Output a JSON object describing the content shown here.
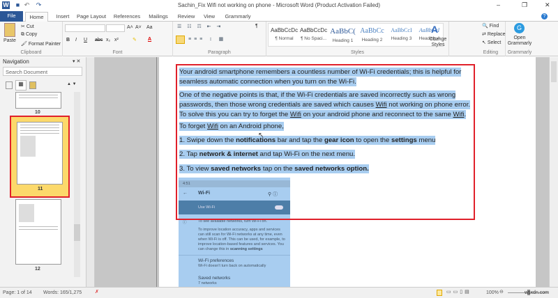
{
  "window": {
    "title": "Sachin_Fix Wifi not working on phone - Microsoft Word (Product Activation Failed)",
    "minimize": "–",
    "restore": "❐",
    "close": "✕"
  },
  "tabs": [
    "File",
    "Home",
    "Insert",
    "Page Layout",
    "References",
    "Mailings",
    "Review",
    "View",
    "Grammarly"
  ],
  "clipboard": {
    "paste": "Paste",
    "cut": "Cut",
    "copy": "Copy",
    "format_painter": "Format Painter",
    "label": "Clipboard"
  },
  "font": {
    "label": "Font",
    "bold": "B",
    "italic": "I",
    "underline": "U",
    "strike": "abc",
    "sub": "x₂",
    "sup": "x²",
    "grow": "A˄",
    "shrink": "A˅",
    "case": "Aa"
  },
  "paragraph": {
    "label": "Paragraph",
    "pilcrow": "¶"
  },
  "styles": {
    "label": "Styles",
    "items": [
      {
        "preview": "AaBbCcDc",
        "name": "¶ Normal"
      },
      {
        "preview": "AaBbCcDc",
        "name": "¶ No Spaci..."
      },
      {
        "preview": "AaBbC(",
        "name": "Heading 1"
      },
      {
        "preview": "AaBbCc",
        "name": "Heading 2"
      },
      {
        "preview": "AaBbCcI",
        "name": "Heading 3"
      },
      {
        "preview": "AaBbCcI",
        "name": "Heading 4"
      }
    ],
    "change_styles": "Change Styles"
  },
  "editing": {
    "label": "Editing",
    "find": "Find",
    "replace": "Replace",
    "select": "Select"
  },
  "grammarly": {
    "label": "Grammarly",
    "open": "Open Grammarly"
  },
  "navigation": {
    "title": "Navigation",
    "search_placeholder": "Search Document",
    "pages": [
      "10",
      "11",
      "12"
    ]
  },
  "document": {
    "p1": "Your android smartphone remembers a countless number of Wi-Fi credentials; this is helpful for seamless automatic connection when you turn on the Wi-Fi.",
    "p2a": "One of the negative points is that, if the Wi-Fi credentials are saved incorrectly such as wrong passwords, then those wrong credentials are saved which causes ",
    "wifi": "Wifi",
    "p2b": " not working on phone error. To solve this you can try to forget the ",
    "p2c": " on your android phone and reconnect to the same ",
    "p2d": ".",
    "p3a": "To forget ",
    "p3b": " on an Android phone,",
    "s1a": "1. Swipe down the ",
    "s1b": "notifications",
    "s1c": " bar and tap the ",
    "s1d": "gear icon",
    "s1e": " to open the ",
    "s1f": "settings",
    "s1g": " menu",
    "s2a": "2. Tap ",
    "s2b": "network & internet",
    "s2c": " and tap Wi-Fi on the next menu.",
    "s3a": "3. To view ",
    "s3b": "saved networks",
    "s3c": " tap on the ",
    "s3d": "saved networks option.",
    "phone": {
      "time": "4:51",
      "header": "Wi-Fi",
      "use_wifi": "Use Wi-Fi",
      "info1": "To see available networks, turn Wi-Fi on.",
      "info2": "To improve location accuracy, apps and services can still scan for Wi-Fi networks at any time, even when Wi-Fi is off. This can be used, for example, to improve location-based features and services. You can change this in ",
      "scanning": "scanning settings",
      "prefs": "Wi-Fi preferences",
      "prefs_sub": "Wi-Fi doesn't turn back on automatically",
      "saved": "Saved networks",
      "saved_sub": "7 networks"
    }
  },
  "status": {
    "page": "Page: 1 of 14",
    "words": "Words: 165/1,275",
    "zoom": "100%",
    "watermark": "wsxdn.com"
  },
  "colors": {
    "accent": "#2b5797",
    "highlight": "#a8cdf0",
    "annotation": "#e0202a"
  }
}
